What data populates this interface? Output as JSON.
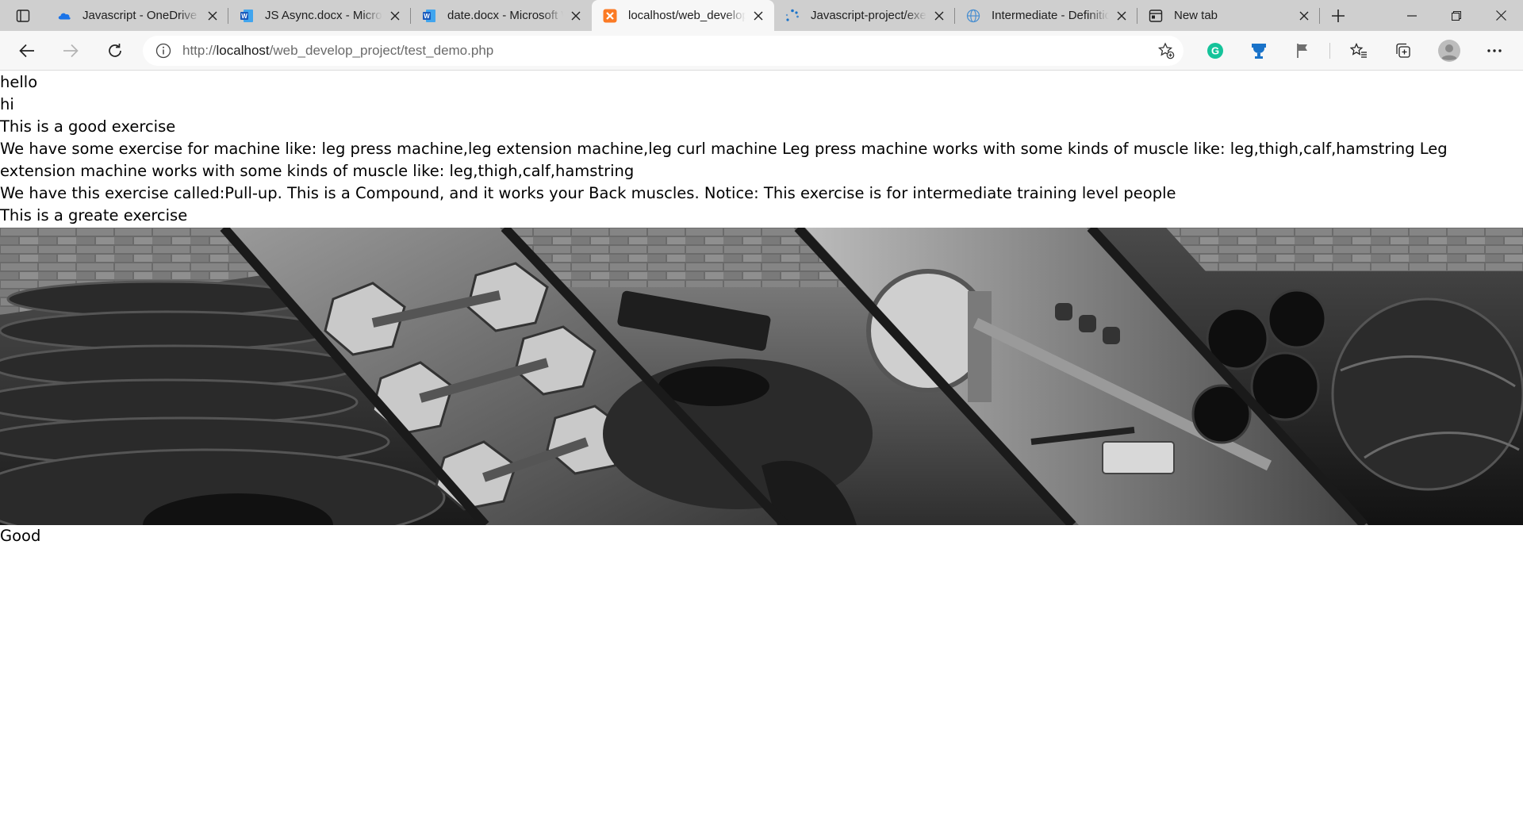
{
  "browser": {
    "tabs": [
      {
        "title": "Javascript - OneDrive",
        "icon": "onedrive-icon",
        "active": false
      },
      {
        "title": "JS Async.docx - Microsoft Word",
        "icon": "word-icon",
        "active": false
      },
      {
        "title": "date.docx - Microsoft Word",
        "icon": "word-icon",
        "active": false
      },
      {
        "title": "localhost/web_develop_project/test_demo.php",
        "icon": "xampp-icon",
        "active": true
      },
      {
        "title": "Javascript-project/exercise",
        "icon": "loading-icon",
        "active": false
      },
      {
        "title": "Intermediate - Definition",
        "icon": "globe-icon",
        "active": false
      },
      {
        "title": "New tab",
        "icon": "newtab-icon",
        "active": false
      }
    ],
    "address": {
      "prefix": "http://",
      "host": "localhost",
      "path": "/web_develop_project/test_demo.php"
    },
    "colors": {
      "grammarly": "#15c39a",
      "extension_blue": "#1a73c9",
      "tabstrip": "#cfcfcf",
      "toolbar": "#f7f7f7"
    }
  },
  "page": {
    "lines": [
      "hello",
      "hi",
      "This is a good exercise",
      "We have some exercise for machine like: leg press machine,leg extension machine,leg curl machine Leg press machine works with some kinds of muscle like: leg,thigh,calf,hamstring Leg extension machine works with some kinds of muscle like: leg,thigh,calf,hamstring",
      "We have this exercise called:Pull-up. This is a Compound, and it works your Back muscles. Notice: This exercise is for intermediate training level people",
      "This is a greate exercise"
    ],
    "after_image": "Good"
  }
}
